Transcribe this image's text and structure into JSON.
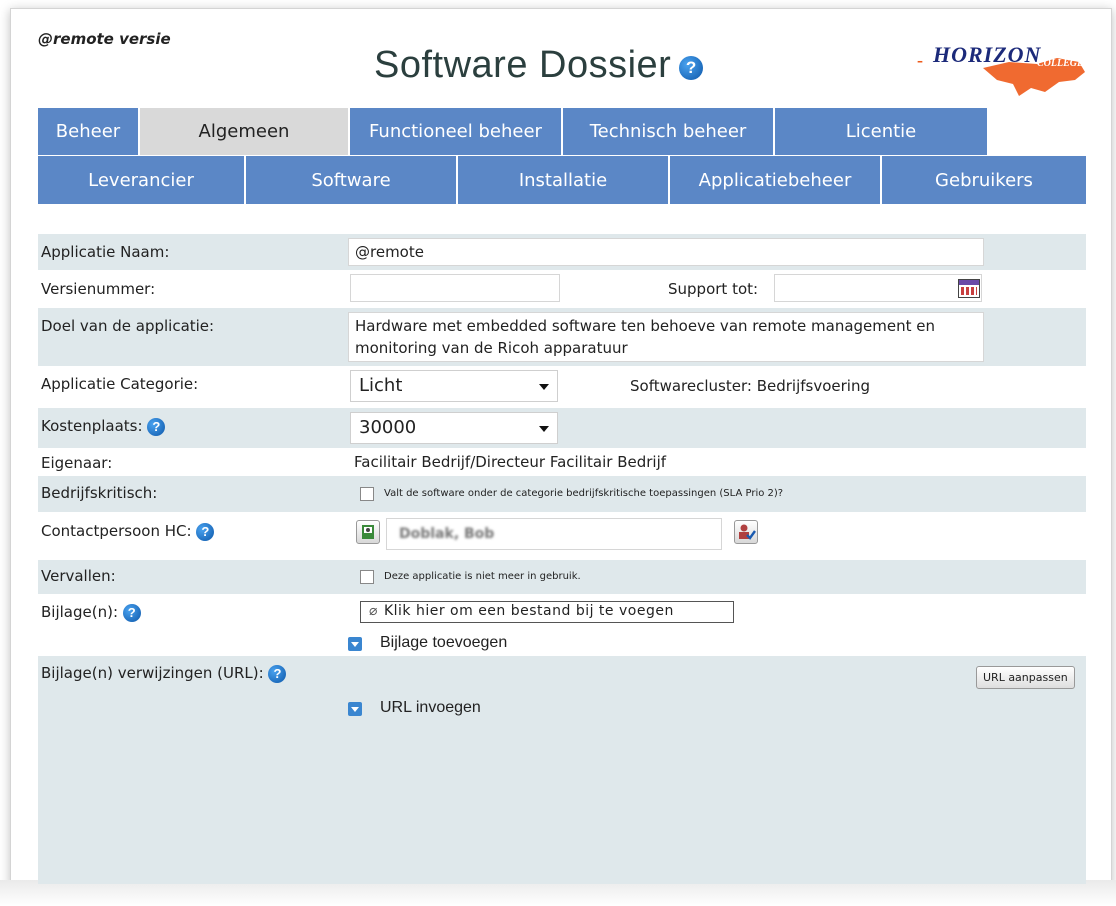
{
  "header": {
    "remote_version": "@remote versie",
    "title": "Software Dossier",
    "help_glyph": "?",
    "logo_text": "HORIZON",
    "logo_sub": "COLLEGE",
    "logo_dash": "-",
    "logo_color": "#ee5a1a"
  },
  "tabs_row1": [
    {
      "label": "Beheer",
      "active": false
    },
    {
      "label": "Algemeen",
      "active": true
    },
    {
      "label": "Functioneel beheer",
      "active": false
    },
    {
      "label": "Technisch beheer",
      "active": false
    },
    {
      "label": "Licentie",
      "active": false
    }
  ],
  "tabs_row2": [
    {
      "label": "Leverancier"
    },
    {
      "label": "Software"
    },
    {
      "label": "Installatie"
    },
    {
      "label": "Applicatiebeheer"
    },
    {
      "label": "Gebruikers"
    }
  ],
  "colors": {
    "tab_blue": "#5b87c6",
    "tab_active": "#d9d9d9",
    "row_shade": "#dfe8eb",
    "help_blue": "#0c56a8"
  },
  "form": {
    "app_name_label": "Applicatie Naam:",
    "app_name_value": "@remote",
    "version_label": "Versienummer:",
    "version_value": "",
    "support_label": "Support tot:",
    "support_value": "",
    "purpose_label": "Doel van de applicatie:",
    "purpose_line1": "Hardware met embedded software ten behoeve van remote management en",
    "purpose_line2": "monitoring van de Ricoh apparatuur",
    "category_label": "Applicatie Categorie:",
    "category_value": "Licht",
    "cluster_text": "Softwarecluster: Bedrijfsvoering",
    "cost_label": "Kostenplaats:",
    "cost_value": "30000",
    "owner_label": "Eigenaar:",
    "owner_value": "Facilitair Bedrijf/Directeur Facilitair Bedrijf",
    "critical_label": "Bedrijfskritisch:",
    "critical_text": "Valt de software onder de categorie bedrijfskritische toepassingen (SLA Prio 2)?",
    "contact_label": "Contactpersoon HC:",
    "contact_value": "Doblak, Bob",
    "expired_label": "Vervallen:",
    "expired_text": "Deze applicatie is niet meer in gebruik.",
    "attach_label": "Bijlage(n):",
    "attach_button": "Klik hier om een bestand bij te voegen",
    "attach_add": "Bijlage toevoegen",
    "url_label": "Bijlage(n) verwijzingen (URL):",
    "url_button": "URL aanpassen",
    "url_add": "URL invoegen"
  }
}
